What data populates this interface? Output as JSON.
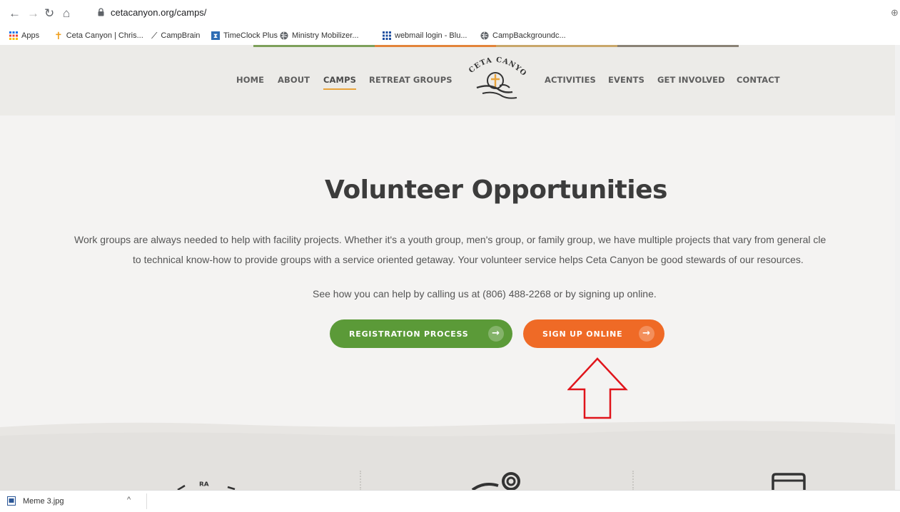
{
  "browser": {
    "url": "cetacanyon.org/camps/",
    "bookmarks": [
      {
        "label": "Apps"
      },
      {
        "label": "Ceta Canyon | Chris..."
      },
      {
        "label": "CampBrain"
      },
      {
        "label": "TimeClock Plus"
      },
      {
        "label": "Ministry Mobilizer..."
      },
      {
        "label": "webmail login - Blu..."
      },
      {
        "label": "CampBackgroundc..."
      }
    ]
  },
  "site": {
    "nav_left": [
      "HOME",
      "ABOUT",
      "CAMPS",
      "RETREAT GROUPS"
    ],
    "nav_right": [
      "ACTIVITIES",
      "EVENTS",
      "GET INVOLVED",
      "CONTACT"
    ],
    "active_nav": "CAMPS",
    "logo_text": "CETA CANYON",
    "title": "Volunteer Opportunities",
    "paragraph_line1": "Work groups are always needed to help with facility projects. Whether it's a youth group, men's group, or family group, we have multiple projects that vary from general cle",
    "paragraph_line2": "to technical know-how to provide groups with a service oriented getaway. Your volunteer service helps Ceta Canyon be good stewards of our resources.",
    "call_line": "See how you can help by calling us at (806) 488-2268 or by signing up online.",
    "buttons": {
      "registration": "REGISTRATION PROCESS",
      "signup": "SIGN UP ONLINE"
    },
    "colors": {
      "green": "#5b9a38",
      "orange": "#ef6a26",
      "accent_underline": "#e8a33b",
      "annotation_red": "#e0141b"
    }
  },
  "downloads": {
    "file_name": "Meme 3.jpg"
  }
}
